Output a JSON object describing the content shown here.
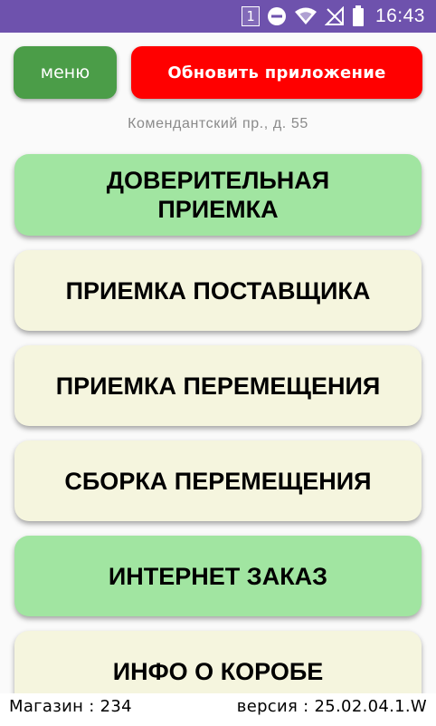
{
  "status_bar": {
    "time": "16:43",
    "sim_number": "1",
    "icons": [
      "sim-badge-icon",
      "do-not-disturb-icon",
      "wifi-icon",
      "no-signal-icon",
      "battery-icon"
    ],
    "background_color": "#6e52ad"
  },
  "header": {
    "menu_label": "меню",
    "update_label": "Обновить приложение",
    "menu_color": "#4b9d48",
    "update_color": "#ff0000"
  },
  "address": "Комендантский пр., д. 55",
  "menu_buttons": [
    {
      "label": "ДОВЕРИТЕЛЬНАЯ ПРИЕМКА",
      "color": "#a1e5a1"
    },
    {
      "label": "ПРИЕМКА ПОСТАВЩИКА",
      "color": "#f5f5de"
    },
    {
      "label": "ПРИЕМКА ПЕРЕМЕЩЕНИЯ",
      "color": "#f5f5de"
    },
    {
      "label": "СБОРКА ПЕРЕМЕЩЕНИЯ",
      "color": "#f5f5de"
    },
    {
      "label": "ИНТЕРНЕТ ЗАКАЗ",
      "color": "#a1e5a1"
    },
    {
      "label": "ИНФО О КОРОБЕ",
      "color": "#f5f5de"
    }
  ],
  "footer": {
    "store": "Магазин : 234",
    "version": "версия : 25.02.04.1.W"
  }
}
